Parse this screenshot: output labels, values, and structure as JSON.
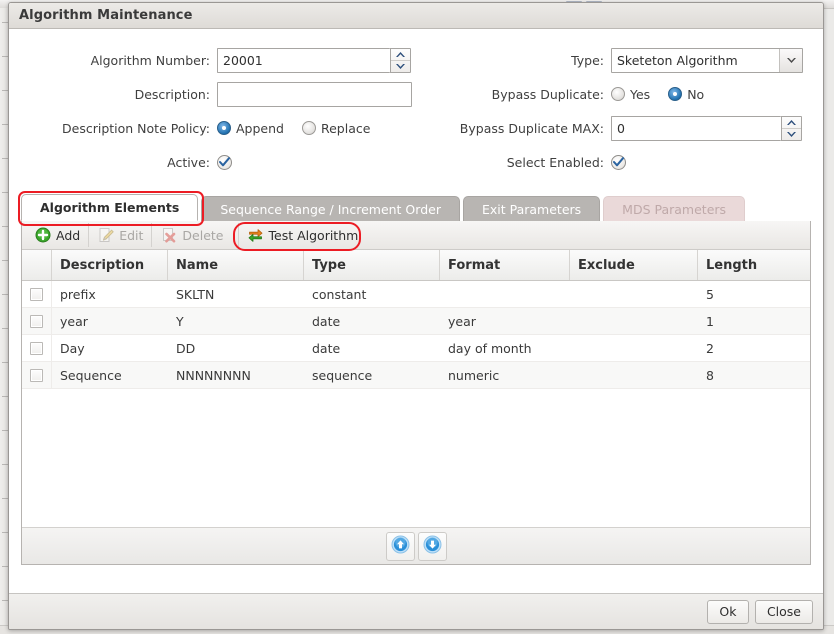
{
  "window": {
    "title": "Algorithm Maintenance"
  },
  "form": {
    "left": [
      {
        "label": "Algorithm Number:",
        "control": "spinner",
        "value": "20001"
      },
      {
        "label": "Description:",
        "control": "text",
        "value": "",
        "placeholder": ""
      },
      {
        "label": "Description Note Policy:",
        "control": "radio",
        "options": [
          "Append",
          "Replace"
        ],
        "selected": "Append"
      },
      {
        "label": "Active:",
        "control": "checkbox",
        "checked": true
      }
    ],
    "right": [
      {
        "label": "Type:",
        "control": "select",
        "value": "Sketeton Algorithm"
      },
      {
        "label": "Bypass Duplicate:",
        "control": "radio",
        "options": [
          "Yes",
          "No"
        ],
        "selected": "No"
      },
      {
        "label": "Bypass Duplicate MAX:",
        "control": "spinner",
        "value": "0"
      },
      {
        "label": "Select Enabled:",
        "control": "checkbox",
        "checked": true
      }
    ]
  },
  "tabs": [
    {
      "label": "Algorithm Elements",
      "state": "active",
      "highlighted": true
    },
    {
      "label": "Sequence Range / Increment Order",
      "state": "inactive",
      "highlighted": false
    },
    {
      "label": "Exit Parameters",
      "state": "inactive",
      "highlighted": false
    },
    {
      "label": "MDS Parameters",
      "state": "disabled",
      "highlighted": false
    }
  ],
  "toolbar": {
    "buttons": [
      {
        "label": "Add",
        "icon": "add-circle-icon",
        "enabled": true,
        "highlighted": false
      },
      {
        "label": "Edit",
        "icon": "pencil-note-icon",
        "enabled": false,
        "highlighted": false
      },
      {
        "label": "Delete",
        "icon": "red-x-icon",
        "enabled": false,
        "highlighted": false
      },
      {
        "label": "Test Algorithm",
        "icon": "swap-arrows-icon",
        "enabled": true,
        "highlighted": true
      }
    ]
  },
  "grid": {
    "columns": [
      "",
      "Description",
      "Name",
      "Type",
      "Format",
      "Exclude",
      "Length"
    ],
    "rows": [
      {
        "checked": false,
        "description": "prefix",
        "name": "SKLTN",
        "type": "constant",
        "format": "",
        "exclude": "",
        "length": "5"
      },
      {
        "checked": false,
        "description": "year",
        "name": "Y",
        "type": "date",
        "format": "year",
        "exclude": "",
        "length": "1"
      },
      {
        "checked": false,
        "description": "Day",
        "name": "DD",
        "type": "date",
        "format": "day of month",
        "exclude": "",
        "length": "2"
      },
      {
        "checked": false,
        "description": "Sequence",
        "name": "NNNNNNNN",
        "type": "sequence",
        "format": "numeric",
        "exclude": "",
        "length": "8"
      }
    ],
    "reorder": {
      "up": "move-up-icon",
      "down": "move-down-icon"
    }
  },
  "footer": {
    "ok": "Ok",
    "close": "Close"
  },
  "colors": {
    "highlight_ring": "#ec1c24",
    "tab_inactive_bg": "#b8b5b2",
    "tab_disabled_bg": "#ead9d9",
    "radio_selected": "#1e6fae",
    "accent_blue": "#2a8fd8",
    "icon_green": "#3aa62a",
    "icon_red": "#d6322a",
    "icon_orange": "#e8821e"
  }
}
